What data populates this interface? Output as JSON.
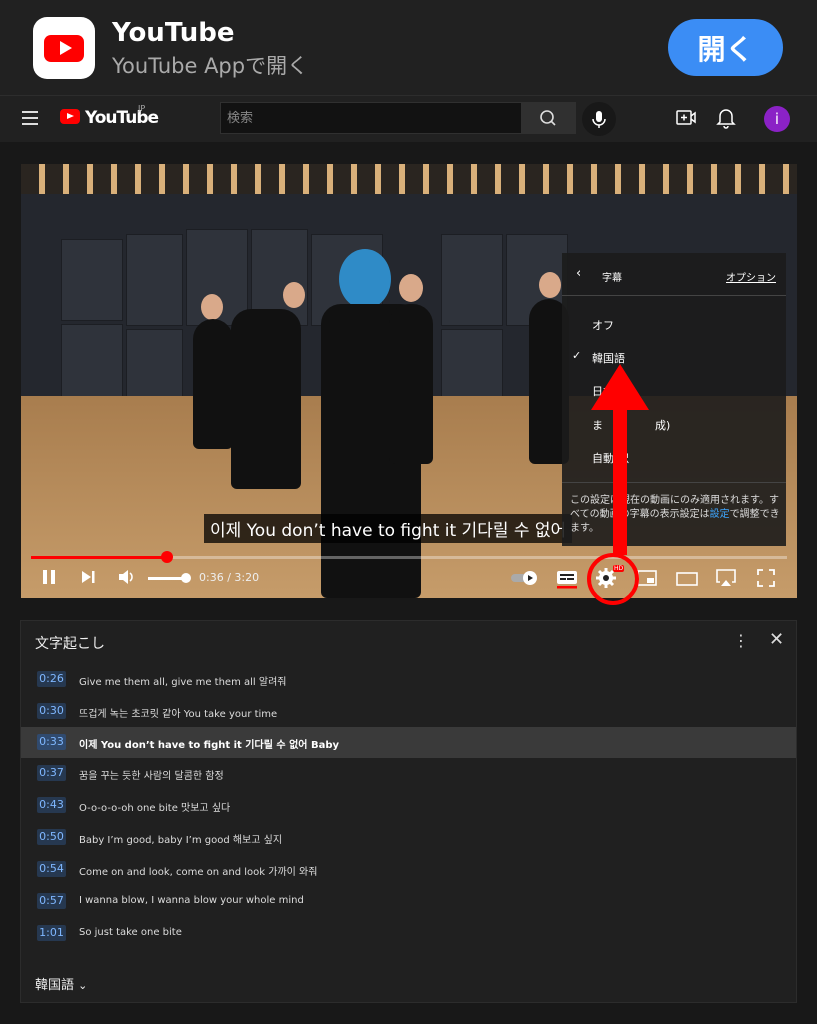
{
  "banner": {
    "app_name": "YouTube",
    "subtitle": "YouTube Appで開く",
    "open_label": "開く"
  },
  "header": {
    "logo_text": "YouTube",
    "logo_region": "JP",
    "search_placeholder": "検索",
    "avatar_letter": "i",
    "icons": [
      "menu-icon",
      "search-icon",
      "mic-icon",
      "create-icon",
      "bell-icon"
    ]
  },
  "video": {
    "subtitle_text": "이제 You don’t have to fight it 기다릴 수 없어",
    "current_time": "0:36",
    "duration": "3:20",
    "progress_fraction": 0.18,
    "volume_fraction": 1.0,
    "separator": " / ",
    "controls": [
      "pause-icon",
      "next-icon",
      "volume-icon",
      "autoplay-toggle",
      "captions-icon",
      "settings-icon",
      "miniplayer-icon",
      "theater-icon",
      "airplay-icon",
      "fullscreen-icon"
    ],
    "hd_badge": "HD"
  },
  "captions_menu": {
    "title": "字幕",
    "options_link": "オプション",
    "items": [
      "オフ",
      "韓国語",
      "日本",
      "ま",
      "自動"
    ],
    "items_partial_suffix": [
      "",
      "",
      "",
      "成)",
      "訳"
    ],
    "selected": "韓国語",
    "note_text": "この設定は現在の動画にのみ適用されます。すべての動画の字幕の表示設定は",
    "note_link": "設定",
    "note_tail": "で調整できます。"
  },
  "transcript": {
    "title": "文字起こし",
    "language": "韓国語",
    "rows": [
      {
        "time": "0:26",
        "text": "Give me them all, give me them all 알려줘"
      },
      {
        "time": "0:30",
        "text": "뜨겁게 녹는 초코릿 같아 You take your time"
      },
      {
        "time": "0:33",
        "text": "이제 You don’t have to fight it 기다릴 수 없어 Baby",
        "active": true
      },
      {
        "time": "0:37",
        "text": "꿈을 꾸는 듯한 사람의 달콤한 함정"
      },
      {
        "time": "0:43",
        "text": "O-o-o-o-oh one bite 맛보고 싶다"
      },
      {
        "time": "0:50",
        "text": "Baby I’m good, baby I’m good 해보고 싶지"
      },
      {
        "time": "0:54",
        "text": "Come on and look, come on and look 가까이 와줘"
      },
      {
        "time": "0:57",
        "text": "I wanna blow, I wanna blow your whole mind"
      },
      {
        "time": "1:01",
        "text": "So just take one bite"
      }
    ]
  },
  "colors": {
    "accent_red": "#ff0000",
    "open_button": "#3b8df5",
    "timestamp_bg": "#263850",
    "timestamp_text": "#7fb7ff"
  }
}
